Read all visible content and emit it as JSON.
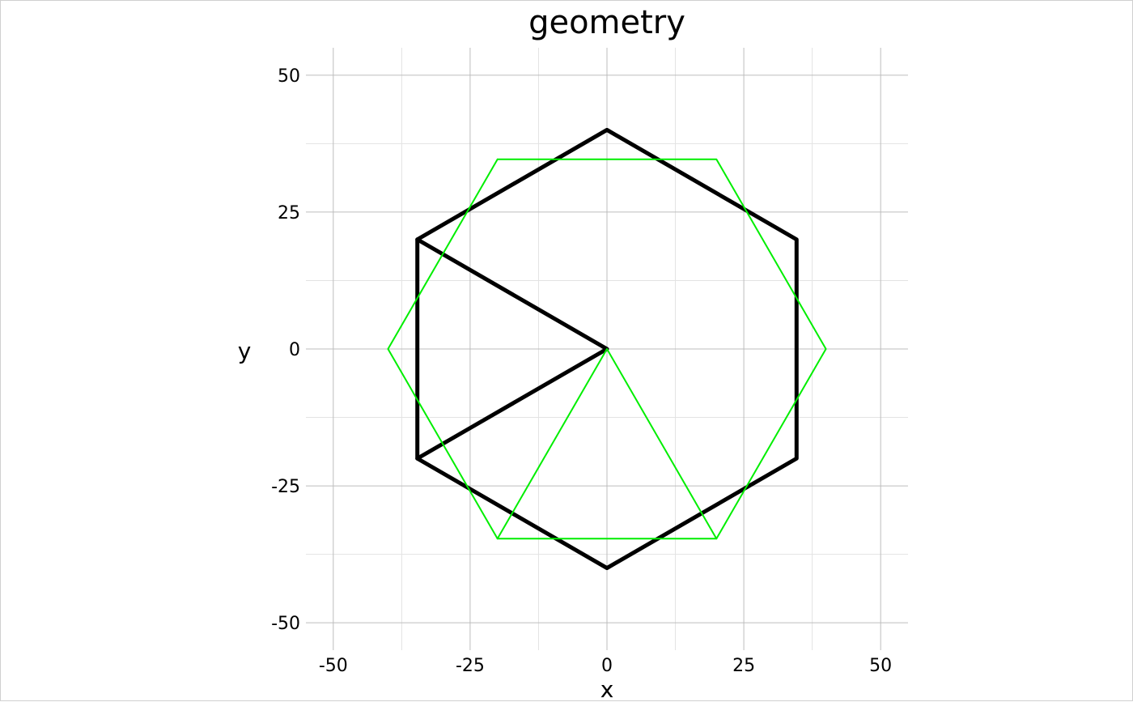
{
  "chart_data": {
    "type": "line",
    "title": "geometry",
    "xlabel": "x",
    "ylabel": "y",
    "xlim": [
      -55,
      55
    ],
    "ylim": [
      -55,
      55
    ],
    "x_ticks": [
      -50,
      -25,
      0,
      25,
      50
    ],
    "y_ticks": [
      -50,
      -25,
      0,
      25,
      50
    ],
    "x_tick_labels": [
      "-50",
      "-25",
      "0",
      "25",
      "50"
    ],
    "y_tick_labels": [
      "-50",
      "-25",
      "0",
      "25",
      "50"
    ],
    "grid": true,
    "legend": "none",
    "series": [
      {
        "color": "#000000",
        "stroke": "thick",
        "points": [
          [
            0,
            40
          ],
          [
            34.64,
            20
          ],
          [
            34.64,
            -20
          ],
          [
            0,
            -40
          ],
          [
            -34.64,
            -20
          ],
          [
            -34.64,
            20
          ],
          [
            0,
            40
          ]
        ]
      },
      {
        "color": "#000000",
        "stroke": "thick",
        "points": [
          [
            -34.64,
            20
          ],
          [
            0,
            0
          ],
          [
            -34.64,
            -20
          ]
        ]
      },
      {
        "color": "#00ee00",
        "stroke": "thin",
        "points": [
          [
            -20,
            34.64
          ],
          [
            20,
            34.64
          ],
          [
            40,
            0
          ],
          [
            20,
            -34.64
          ],
          [
            -20,
            -34.64
          ],
          [
            -40,
            0
          ],
          [
            -20,
            34.64
          ]
        ]
      },
      {
        "color": "#00ee00",
        "stroke": "thin",
        "points": [
          [
            -20,
            -34.64
          ],
          [
            0,
            0
          ],
          [
            20,
            -34.64
          ]
        ]
      }
    ]
  }
}
